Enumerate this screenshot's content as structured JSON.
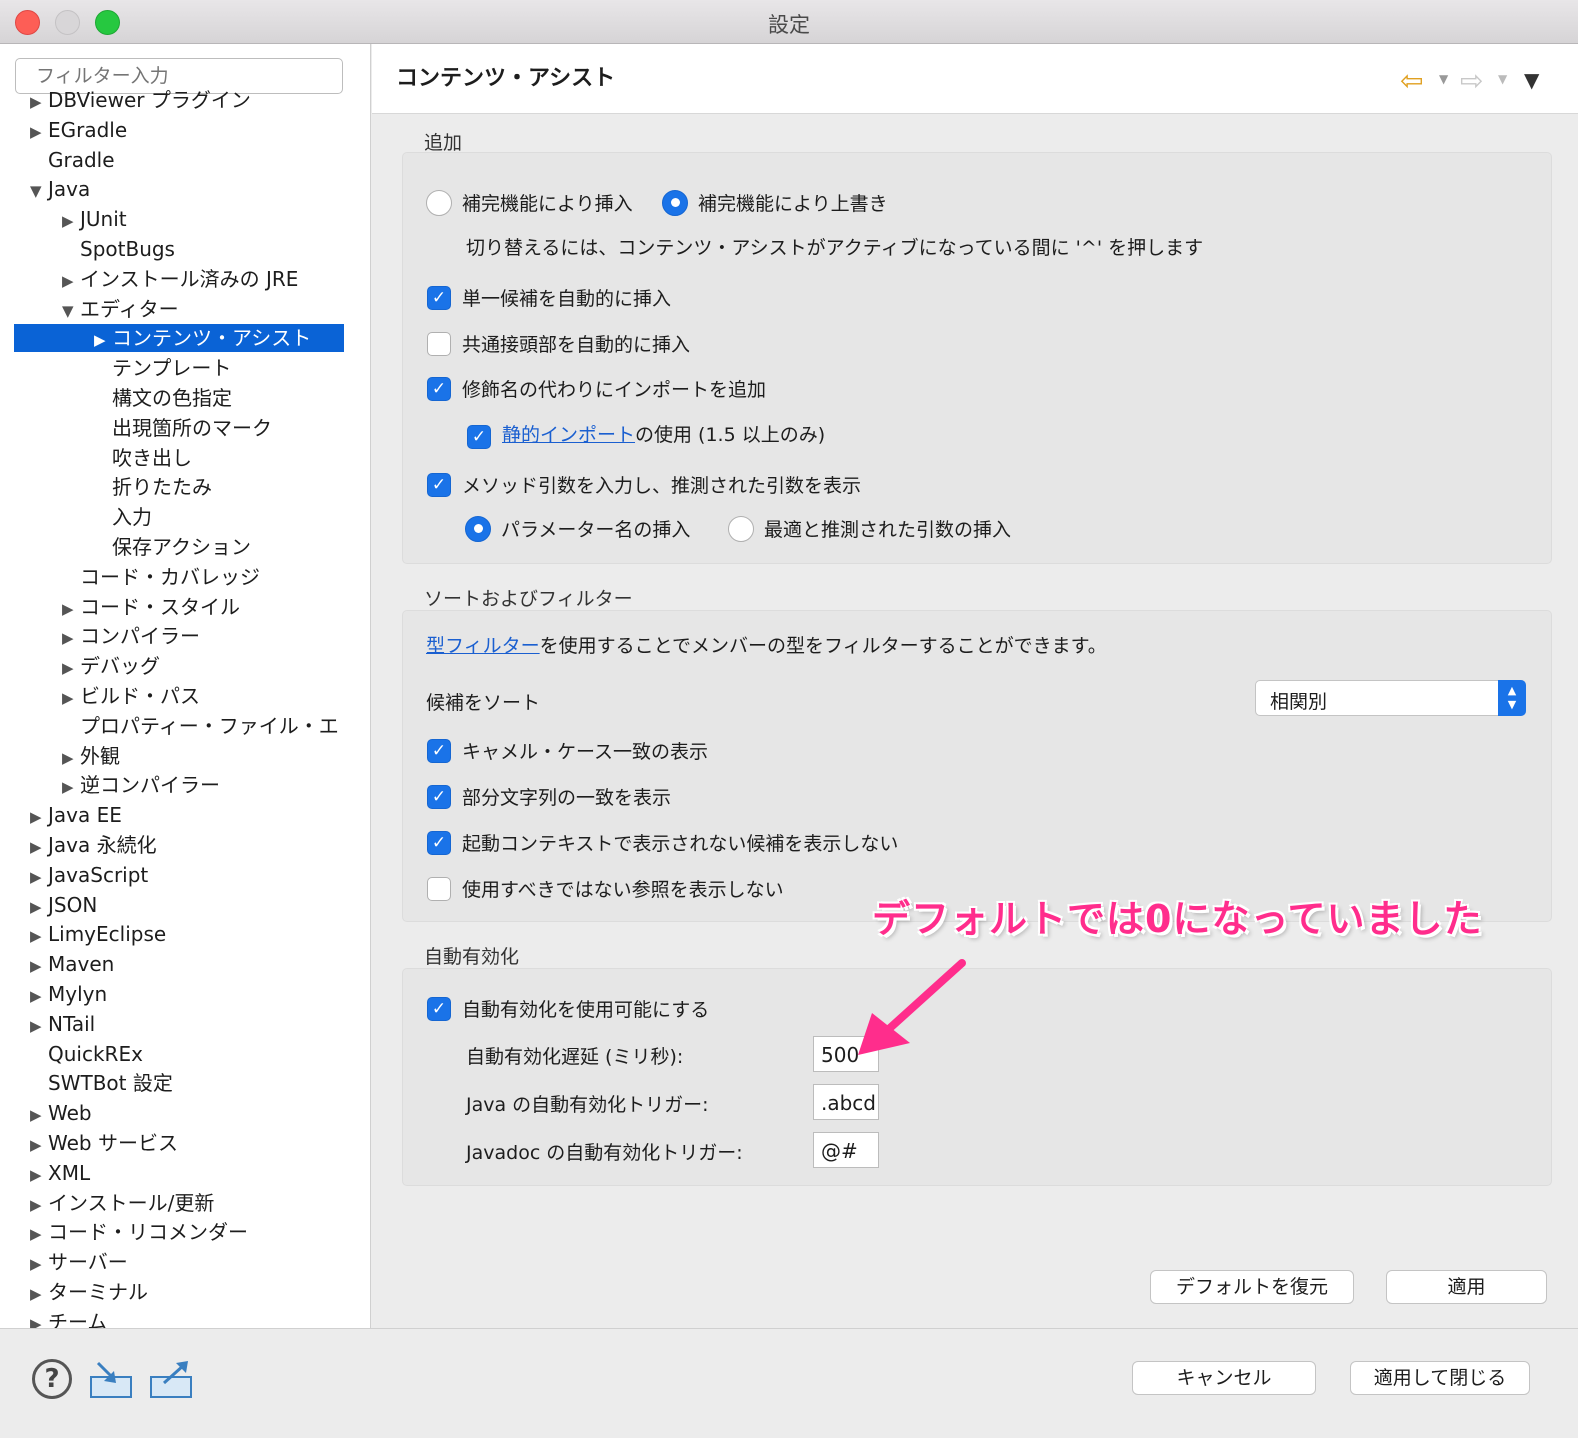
{
  "window": {
    "title": "設定"
  },
  "sidebar": {
    "filter_placeholder": "フィルター入力",
    "items": [
      {
        "label": "DBViewer プラグイン",
        "level": 1,
        "arrow": "▶"
      },
      {
        "label": "EGradle",
        "level": 1,
        "arrow": "▶"
      },
      {
        "label": "Gradle",
        "level": 1,
        "arrow": ""
      },
      {
        "label": "Java",
        "level": 1,
        "arrow": "▼"
      },
      {
        "label": "JUnit",
        "level": 2,
        "arrow": "▶"
      },
      {
        "label": "SpotBugs",
        "level": 2,
        "arrow": ""
      },
      {
        "label": "インストール済みの JRE",
        "level": 2,
        "arrow": "▶"
      },
      {
        "label": "エディター",
        "level": 2,
        "arrow": "▼"
      },
      {
        "label": "コンテンツ・アシスト",
        "level": 3,
        "arrow": "▶",
        "selected": true
      },
      {
        "label": "テンプレート",
        "level": 3,
        "arrow": ""
      },
      {
        "label": "構文の色指定",
        "level": 3,
        "arrow": ""
      },
      {
        "label": "出現箇所のマーク",
        "level": 3,
        "arrow": ""
      },
      {
        "label": "吹き出し",
        "level": 3,
        "arrow": ""
      },
      {
        "label": "折りたたみ",
        "level": 3,
        "arrow": ""
      },
      {
        "label": "入力",
        "level": 3,
        "arrow": ""
      },
      {
        "label": "保存アクション",
        "level": 3,
        "arrow": ""
      },
      {
        "label": "コード・カバレッジ",
        "level": 2,
        "arrow": ""
      },
      {
        "label": "コード・スタイル",
        "level": 2,
        "arrow": "▶"
      },
      {
        "label": "コンパイラー",
        "level": 2,
        "arrow": "▶"
      },
      {
        "label": "デバッグ",
        "level": 2,
        "arrow": "▶"
      },
      {
        "label": "ビルド・パス",
        "level": 2,
        "arrow": "▶"
      },
      {
        "label": "プロパティー・ファイル・エ",
        "level": 2,
        "arrow": ""
      },
      {
        "label": "外観",
        "level": 2,
        "arrow": "▶"
      },
      {
        "label": "逆コンパイラー",
        "level": 2,
        "arrow": "▶"
      },
      {
        "label": "Java EE",
        "level": 1,
        "arrow": "▶"
      },
      {
        "label": "Java 永続化",
        "level": 1,
        "arrow": "▶"
      },
      {
        "label": "JavaScript",
        "level": 1,
        "arrow": "▶"
      },
      {
        "label": "JSON",
        "level": 1,
        "arrow": "▶"
      },
      {
        "label": "LimyEclipse",
        "level": 1,
        "arrow": "▶"
      },
      {
        "label": "Maven",
        "level": 1,
        "arrow": "▶"
      },
      {
        "label": "Mylyn",
        "level": 1,
        "arrow": "▶"
      },
      {
        "label": "NTail",
        "level": 1,
        "arrow": "▶"
      },
      {
        "label": "QuickREx",
        "level": 1,
        "arrow": ""
      },
      {
        "label": "SWTBot 設定",
        "level": 1,
        "arrow": ""
      },
      {
        "label": "Web",
        "level": 1,
        "arrow": "▶"
      },
      {
        "label": "Web サービス",
        "level": 1,
        "arrow": "▶"
      },
      {
        "label": "XML",
        "level": 1,
        "arrow": "▶"
      },
      {
        "label": "インストール/更新",
        "level": 1,
        "arrow": "▶"
      },
      {
        "label": "コード・リコメンダー",
        "level": 1,
        "arrow": "▶"
      },
      {
        "label": "サーバー",
        "level": 1,
        "arrow": "▶"
      },
      {
        "label": "ターミナル",
        "level": 1,
        "arrow": "▶"
      },
      {
        "label": "チーム",
        "level": 1,
        "arrow": "▶"
      }
    ]
  },
  "page": {
    "title": "コンテンツ・アシスト",
    "insertion": {
      "label": "追加",
      "radio_insert": {
        "label": "補完機能により挿入",
        "checked": false
      },
      "radio_overwrite": {
        "label": "補完機能により上書き",
        "checked": true
      },
      "hint": "切り替えるには、コンテンツ・アシストがアクティブになっている間に '^' を押します",
      "single_proposal": {
        "label": "単一候補を自動的に挿入",
        "checked": true
      },
      "common_prefix": {
        "label": "共通接頭部を自動的に挿入",
        "checked": false
      },
      "add_import": {
        "label": "修飾名の代わりにインポートを追加",
        "checked": true
      },
      "static_import": {
        "link": "静的インポート",
        "suffix": " の使用 (1.5 以上のみ)",
        "checked": true
      },
      "fill_args": {
        "label": "メソッド引数を入力し、推測された引数を表示",
        "checked": true
      },
      "radio_param_names": {
        "label": "パラメーター名の挿入",
        "checked": true
      },
      "radio_best_guess": {
        "label": "最適と推測された引数の挿入",
        "checked": false
      }
    },
    "sorting": {
      "label": "ソートおよびフィルター",
      "type_filter_link": "型フィルター",
      "type_filter_text": "を使用することでメンバーの型をフィルターすることができます。",
      "sort_label": "候補をソート",
      "sort_value": "相関別",
      "camel_case": {
        "label": "キャメル・ケース一致の表示",
        "checked": true
      },
      "substring": {
        "label": "部分文字列の一致を表示",
        "checked": true
      },
      "hide_not_visible": {
        "label": "起動コンテキストで表示されない候補を表示しない",
        "checked": true
      },
      "hide_deprecated": {
        "label": "使用すべきではない参照を表示しない",
        "checked": false
      }
    },
    "auto_activation": {
      "label": "自動有効化",
      "enable": {
        "label": "自動有効化を使用可能にする",
        "checked": true
      },
      "delay_label": "自動有効化遅延 (ミリ秒):",
      "delay_value": "500",
      "java_trigger_label": "Java の自動有効化トリガー:",
      "java_trigger_value": ".abcd",
      "javadoc_trigger_label": "Javadoc の自動有効化トリガー:",
      "javadoc_trigger_value": "@#"
    },
    "restore_defaults_label": "デフォルトを復元",
    "apply_label": "適用"
  },
  "annotation": {
    "text": "デフォルトでは0になっていました",
    "color": "#ff2d8c"
  },
  "footer": {
    "cancel_label": "キャンセル",
    "apply_close_label": "適用して閉じる"
  },
  "colors": {
    "accent": "#1a73e8",
    "selection": "#0a63d6",
    "back_arrow": "#e0a020"
  }
}
